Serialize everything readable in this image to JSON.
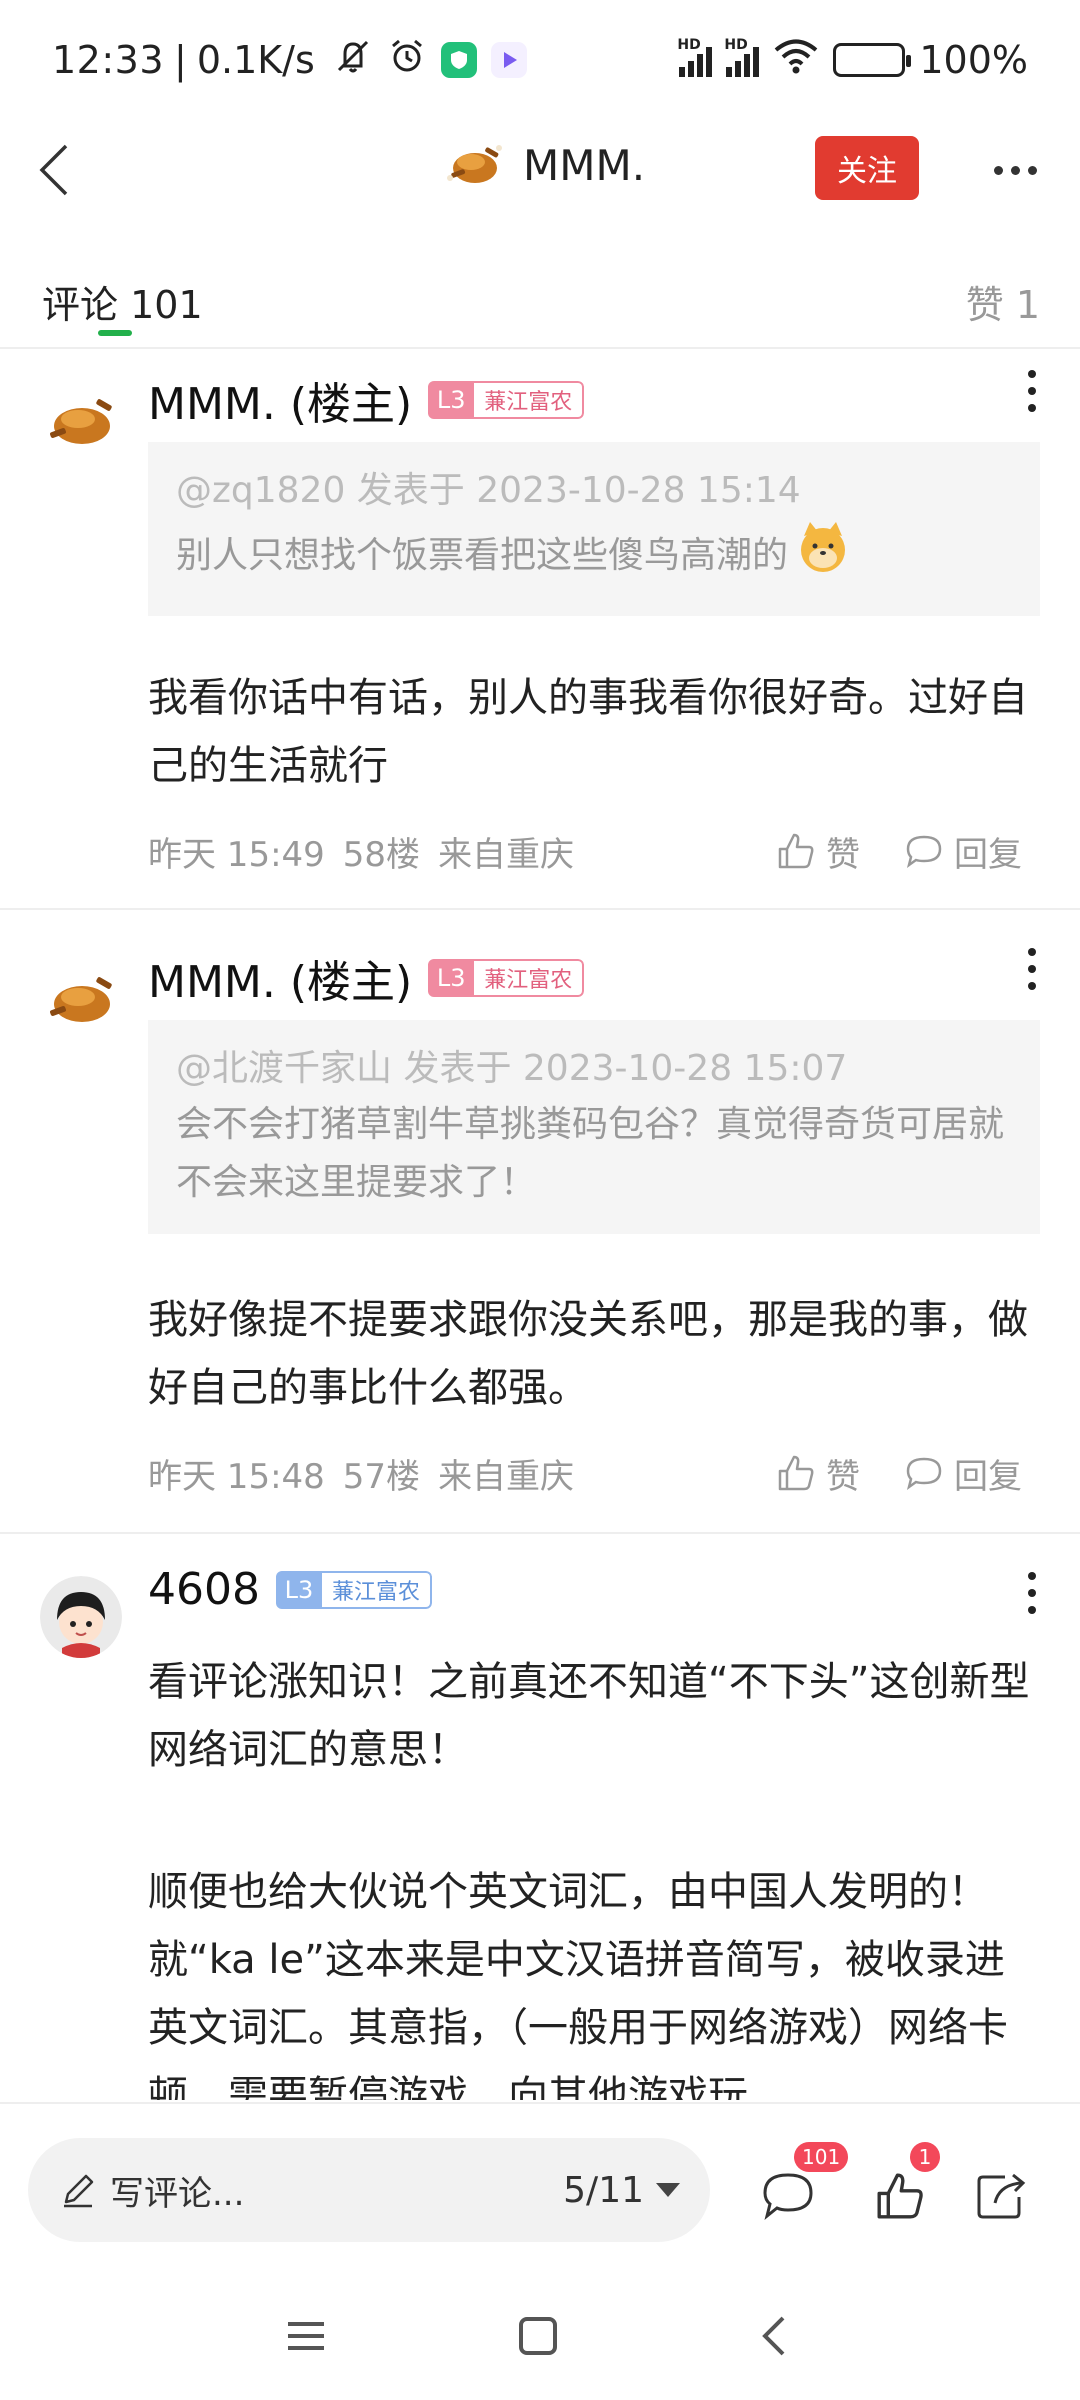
{
  "status_bar": {
    "time": "12:33",
    "net_speed": "0.1K/s",
    "battery": "100%",
    "battery_level": 1.0,
    "icons": [
      "mute-icon",
      "alarm-icon",
      "app-shield-icon",
      "app-play-icon",
      "hd-signal-icon",
      "hd-signal-icon",
      "wifi-icon",
      "battery-charging-icon"
    ]
  },
  "header": {
    "back_icon": "chevron-left-icon",
    "title": "MMM.",
    "avatar_icon": "roast-chicken-avatar",
    "follow_label": "关注",
    "more_icon": "more-horizontal-icon"
  },
  "tabs": {
    "comments_label": "评论",
    "comments_count": "101",
    "likes_label": "赞",
    "likes_count": "1",
    "accent_color": "#22b04b"
  },
  "comments": [
    {
      "author": "MMM. (楼主)",
      "level": "L3",
      "title": "蒹江富农",
      "quote_head": "@zq1820 发表于 2023-10-28 15:14",
      "quote_text": "别人只想找个饭票看把这些傻鸟高潮的",
      "quote_emoji": "doge-emoji",
      "text": "我看你话中有话，别人的事我看你很好奇。过好自己的生活就行",
      "time": "昨天 15:49",
      "floor": "58楼",
      "location": "来自重庆",
      "like_label": "赞",
      "reply_label": "回复"
    },
    {
      "author": "MMM. (楼主)",
      "level": "L3",
      "title": "蒹江富农",
      "quote_head": "@北渡千家山 发表于 2023-10-28 15:07",
      "quote_text": "会不会打猪草割牛草挑粪码包谷？真觉得奇货可居就不会来这里提要求了！",
      "text": "我好像提不提要求跟你没关系吧，那是我的事，做好自己的事比什么都强。",
      "time": "昨天 15:48",
      "floor": "57楼",
      "location": "来自重庆",
      "like_label": "赞",
      "reply_label": "回复"
    },
    {
      "author": "4608",
      "level": "L3",
      "title": "蒹江富农",
      "text_p1": "看评论涨知识！之前真还不知道“不下头”这创新型网络词汇的意思！",
      "text_p2": "顺便也给大伙说个英文词汇，由中国人发明的！就“ka le”这本来是中文汉语拼音简写，被收录进英文词汇。其意指，（一般用于网络游戏）网络卡顿，需要暂停游戏，向其他游戏玩"
    }
  ],
  "bottom_bar": {
    "compose_placeholder": "写评论...",
    "page_indicator": "5/11",
    "comment_count": "101",
    "like_count": "1",
    "badge_color": "#f3485a"
  },
  "system_nav": [
    "menu-icon",
    "home-square-icon",
    "back-chevron-icon"
  ]
}
